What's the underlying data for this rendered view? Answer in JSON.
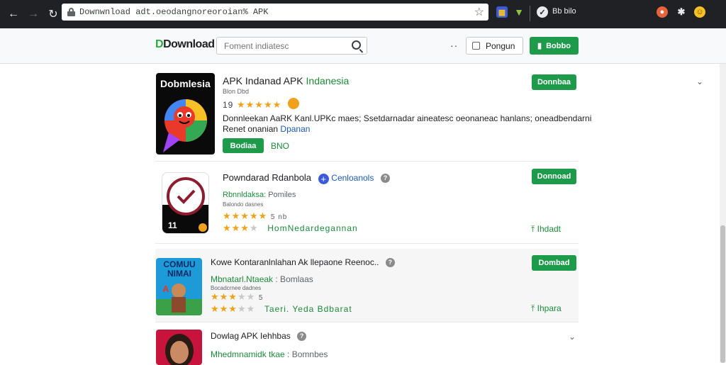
{
  "browser": {
    "url": "Downwnload adt.oeodangnoreoroian% APK",
    "extension_label": "Bb bilo"
  },
  "header": {
    "logo_first": "D",
    "logo_rest": "Download",
    "search_placeholder": "Foment indiatesc",
    "menu_dots": "··",
    "signin_label": "Pongun",
    "download_label": "Bobbo"
  },
  "apps": [
    {
      "thumb_text": "Dobmlesia",
      "title": "APK Indanad APK",
      "title_accent": "Indanesia",
      "subtitle": "Blon Dbd",
      "rating_text": "19",
      "stars": 5,
      "description_line1": "Donnleekan AaRK Kanl.UPKc maes; Ssetdarnadar aineatesc oeonaneac hanlans; oneadbendarni",
      "description_line2_plain": "Renet onanian",
      "description_line2_link": "Dpanan",
      "primary_button": "Bodiaa",
      "secondary_link": "BNO",
      "download_label": "Donnbaa"
    },
    {
      "thumb_badge": "11",
      "title": "Powndarad Rdanbola",
      "tag": "Cenloanols",
      "subtitle_accent": "Rbnnldaksa:",
      "subtitle_plain": "Pomiles",
      "meta": "Balondo dasnes",
      "rating_text": "5 nb",
      "stars_row1": 5,
      "stars_row2": 3,
      "side_note": "HomNedardegannan",
      "download_label": "Donnoad",
      "side_link": "Ihdadt"
    },
    {
      "thumb_text": "COMUU NIMAI",
      "title": "Kowe Kontaranlnlahan Ak llepaone Reenoc..",
      "subtitle_accent": "Mbnatarl.Ntaeak",
      "subtitle_plain": ": Bomlaas",
      "meta": "Bocadcrnee dadnes",
      "rating_text": "5",
      "stars_row1": 3,
      "stars_row2": 3,
      "side_note": "Taeri. Yeda Bdbarat",
      "download_label": "Dombad",
      "side_link": "Ihpara"
    },
    {
      "title": "Dowlag APK Iehhbas",
      "subtitle_accent": "Mhedmnamidk tkae :",
      "subtitle_plain": "Bomnbes"
    }
  ]
}
